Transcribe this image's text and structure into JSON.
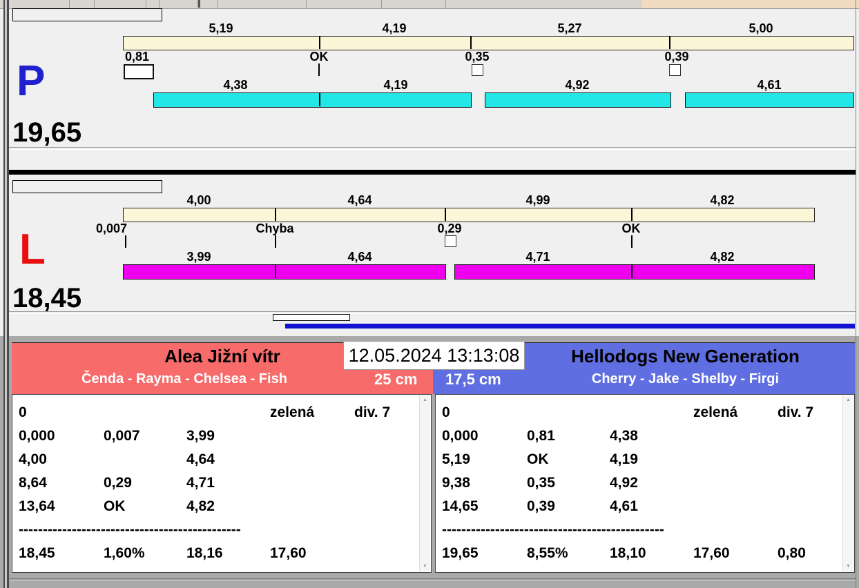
{
  "datetime": "12.05.2024 13:13:08",
  "lane_p": {
    "id_label": "P",
    "total": "19,65",
    "split_labels": [
      "5,19",
      "4,19",
      "5,27",
      "5,00"
    ],
    "gate_labels": [
      "0,81",
      "OK",
      "0,35",
      "0,39"
    ],
    "leg_labels": [
      "4,38",
      "4,19",
      "4,92",
      "4,61"
    ]
  },
  "lane_l": {
    "id_label": "L",
    "total": "18,45",
    "split_labels": [
      "4,00",
      "4,64",
      "4,99",
      "4,82"
    ],
    "gate_labels": [
      "0,007",
      "Chyba",
      "0,29",
      "OK"
    ],
    "leg_labels": [
      "3,99",
      "4,64",
      "4,71",
      "4,82"
    ]
  },
  "team_left": {
    "name": "Alea Jižní vítr",
    "dogs": "Čenda - Rayma - Chelsea - Fish",
    "jump_height": "25 cm",
    "separator": "----------------------------------------------",
    "rows": [
      [
        "0",
        "",
        "",
        "zelená",
        "div. 7"
      ],
      [
        "0,000",
        "0,007",
        "3,99",
        "",
        ""
      ],
      [
        "4,00",
        "",
        "4,64",
        "",
        ""
      ],
      [
        "8,64",
        "0,29",
        "4,71",
        "",
        ""
      ],
      [
        "13,64",
        "OK",
        "4,82",
        "",
        ""
      ],
      [
        "18,45",
        "1,60%",
        "18,16",
        "17,60",
        ""
      ]
    ]
  },
  "team_right": {
    "name": "Hellodogs New Generation",
    "dogs": "Cherry - Jake - Shelby - Firgi",
    "jump_height": "17,5 cm",
    "separator": "----------------------------------------------",
    "rows": [
      [
        "0",
        "",
        "",
        "zelená",
        "div. 7"
      ],
      [
        "0,000",
        "0,81",
        "4,38",
        "",
        ""
      ],
      [
        "5,19",
        "OK",
        "4,19",
        "",
        ""
      ],
      [
        "9,38",
        "0,35",
        "4,92",
        "",
        ""
      ],
      [
        "14,65",
        "0,39",
        "4,61",
        "",
        ""
      ],
      [
        "19,65",
        "8,55%",
        "18,10",
        "17,60",
        "0,80"
      ]
    ]
  },
  "icons": {
    "scroll_up": "▲",
    "scroll_down": "▼"
  },
  "colors": {
    "lane_p_accent": "#2021CE",
    "lane_l_accent": "#E90F0F",
    "split_bar": "#FBF6D8",
    "leg_bar_p": "#23E6E6",
    "leg_bar_l": "#EE00EE",
    "traffic_red": "#FF0000",
    "traffic_yellow": "#FFF200",
    "traffic_green": "#00E040",
    "team_left_bg": "#F76B6B",
    "team_right_bg": "#5F6EE0",
    "progress_bar": "#1212D0"
  }
}
